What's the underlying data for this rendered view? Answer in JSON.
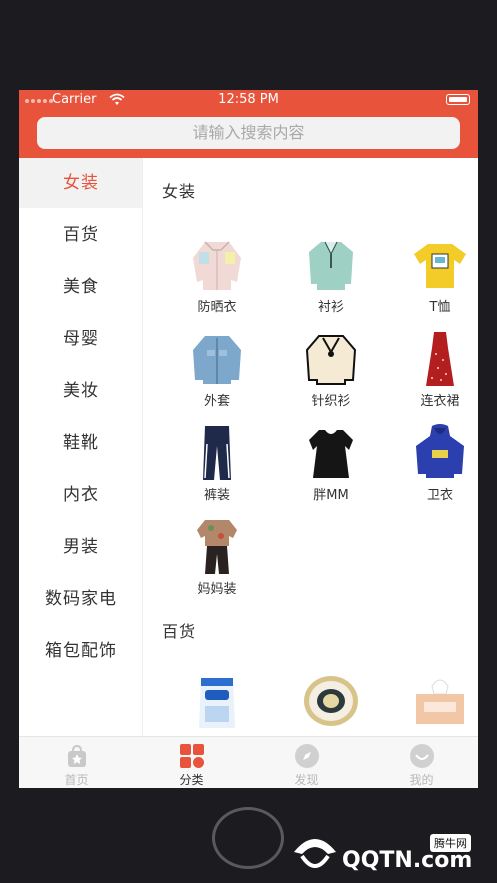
{
  "status_bar": {
    "carrier": "Carrier",
    "time": "12:58 PM"
  },
  "search": {
    "placeholder": "请输入搜索内容"
  },
  "sidebar": {
    "items": [
      {
        "label": "女装"
      },
      {
        "label": "百货"
      },
      {
        "label": "美食"
      },
      {
        "label": "母婴"
      },
      {
        "label": "美妆"
      },
      {
        "label": "鞋靴"
      },
      {
        "label": "内衣"
      },
      {
        "label": "男装"
      },
      {
        "label": "数码家电"
      },
      {
        "label": "箱包配饰"
      }
    ],
    "active_index": 0
  },
  "sections": [
    {
      "title": "女装",
      "items": [
        {
          "label": "防晒衣",
          "icon": "sun-jacket-image"
        },
        {
          "label": "衬衫",
          "icon": "shirt-image"
        },
        {
          "label": "T恤",
          "icon": "tshirt-image"
        },
        {
          "label": "外套",
          "icon": "denim-jacket-image"
        },
        {
          "label": "针织衫",
          "icon": "cardigan-image"
        },
        {
          "label": "连衣裙",
          "icon": "dress-image"
        },
        {
          "label": "裤装",
          "icon": "pants-image"
        },
        {
          "label": "胖MM",
          "icon": "plus-size-dress-image"
        },
        {
          "label": "卫衣",
          "icon": "hoodie-image"
        },
        {
          "label": "妈妈装",
          "icon": "mom-outfit-image"
        }
      ]
    },
    {
      "title": "百货",
      "items": [
        {
          "label": "",
          "icon": "detergent-image"
        },
        {
          "label": "",
          "icon": "plate-image"
        },
        {
          "label": "",
          "icon": "tissue-box-image"
        }
      ]
    }
  ],
  "tabbar": {
    "items": [
      {
        "label": "首页",
        "icon": "home-bag-icon"
      },
      {
        "label": "分类",
        "icon": "category-grid-icon"
      },
      {
        "label": "发现",
        "icon": "compass-icon"
      },
      {
        "label": "我的",
        "icon": "profile-icon"
      }
    ],
    "active_index": 1
  },
  "watermark": {
    "badge": "腾牛网",
    "text": "QQTN.com"
  },
  "colors": {
    "accent": "#e8533c",
    "sidebar_active_bg": "#f2f2f2",
    "tab_inactive": "#b8b8b8"
  }
}
